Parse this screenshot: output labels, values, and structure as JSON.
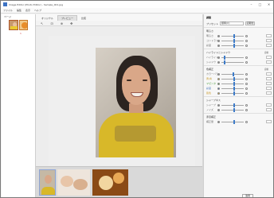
{
  "window": {
    "title": "Image Editor (Photo Editor) - Sample_001.jpg"
  },
  "menu": [
    "ファイル",
    "編集",
    "表示",
    "ヘルプ"
  ],
  "left_panel": {
    "title": "ページ",
    "page_number": "1"
  },
  "tabs": [
    {
      "label": "オリジナル",
      "active": false
    },
    {
      "label": "プレビュー",
      "active": true
    },
    {
      "label": "比較",
      "active": false
    }
  ],
  "toolbar": {
    "icons": [
      "pointer-icon",
      "crop-icon",
      "zoom-icon",
      "hand-icon"
    ],
    "glyphs": [
      "↖",
      "⊡",
      "⊕",
      "✥"
    ]
  },
  "right_panel": {
    "title": "調整",
    "mode_label": "プリセット",
    "mode_value": "標準(C)",
    "reset_label": "初期化",
    "sections": [
      {
        "name": "明るさ",
        "rows": [
          {
            "label": "明るさ",
            "color": "c4",
            "pos": 0.55
          },
          {
            "label": "コントラスト",
            "color": "c4",
            "pos": 0.55
          }
        ]
      },
      {
        "name": "",
        "rows": [
          {
            "label": "彩度",
            "color": "c4",
            "pos": 0.55
          }
        ]
      },
      {
        "name": "ハイライトとシャドウ",
        "note": "自動",
        "rows": [
          {
            "label": "ハイライト",
            "color": "c4",
            "pos": 0.1
          },
          {
            "label": "シャドウ",
            "color": "c4",
            "pos": 0.1
          }
        ]
      },
      {
        "name": "色補正",
        "note": "自動",
        "rows": [
          {
            "label": "カラーバランス",
            "color": "c4",
            "pos": 0.5
          },
          {
            "label": "黄/青",
            "color": "c1",
            "pos": 0.55
          },
          {
            "label": "マゼンタ",
            "color": "c2",
            "pos": 0.55
          },
          {
            "label": "彩度",
            "color": "c3",
            "pos": 0.55
          },
          {
            "label": "肌色",
            "color": "c1",
            "pos": 0.55
          }
        ]
      },
      {
        "name": "シャープネス",
        "rows": [
          {
            "label": "シャープ",
            "color": "c4",
            "pos": 0.55
          },
          {
            "label": "ノイズ",
            "color": "c4",
            "pos": 0.55
          }
        ]
      },
      {
        "name": "赤目補正",
        "rows": [
          {
            "label": "補正量",
            "color": "c4",
            "pos": 0.55
          }
        ]
      }
    ],
    "ok_label": "適用"
  },
  "filmstrip": {
    "count": 3
  }
}
